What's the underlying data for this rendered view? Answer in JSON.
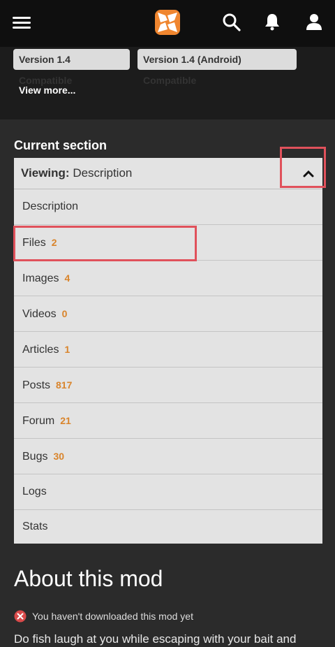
{
  "tags": [
    "Version 1.4 Compatible",
    "Version 1.4 (Android) Compatible"
  ],
  "view_more": "View more...",
  "section": {
    "heading": "Current section",
    "viewing_label": "Viewing:",
    "viewing_value": "Description",
    "items": [
      {
        "label": "Description",
        "count": ""
      },
      {
        "label": "Files",
        "count": "2"
      },
      {
        "label": "Images",
        "count": "4"
      },
      {
        "label": "Videos",
        "count": "0"
      },
      {
        "label": "Articles",
        "count": "1"
      },
      {
        "label": "Posts",
        "count": "817"
      },
      {
        "label": "Forum",
        "count": "21"
      },
      {
        "label": "Bugs",
        "count": "30"
      },
      {
        "label": "Logs",
        "count": ""
      },
      {
        "label": "Stats",
        "count": ""
      }
    ]
  },
  "about": {
    "title": "About this mod",
    "warning": "You haven't downloaded this mod yet",
    "description": "Do fish laugh at you while escaping with your bait and"
  },
  "icons": {
    "menu": "hamburger-menu-icon",
    "logo": "nexus-logo",
    "search": "search-icon",
    "notifications": "bell-icon",
    "account": "user-icon",
    "collapse": "chevron-up-icon",
    "warning": "error-circle-icon"
  },
  "colors": {
    "accent": "#d9842b",
    "highlight": "#e0515b",
    "logo_orange": "#f0862f"
  }
}
